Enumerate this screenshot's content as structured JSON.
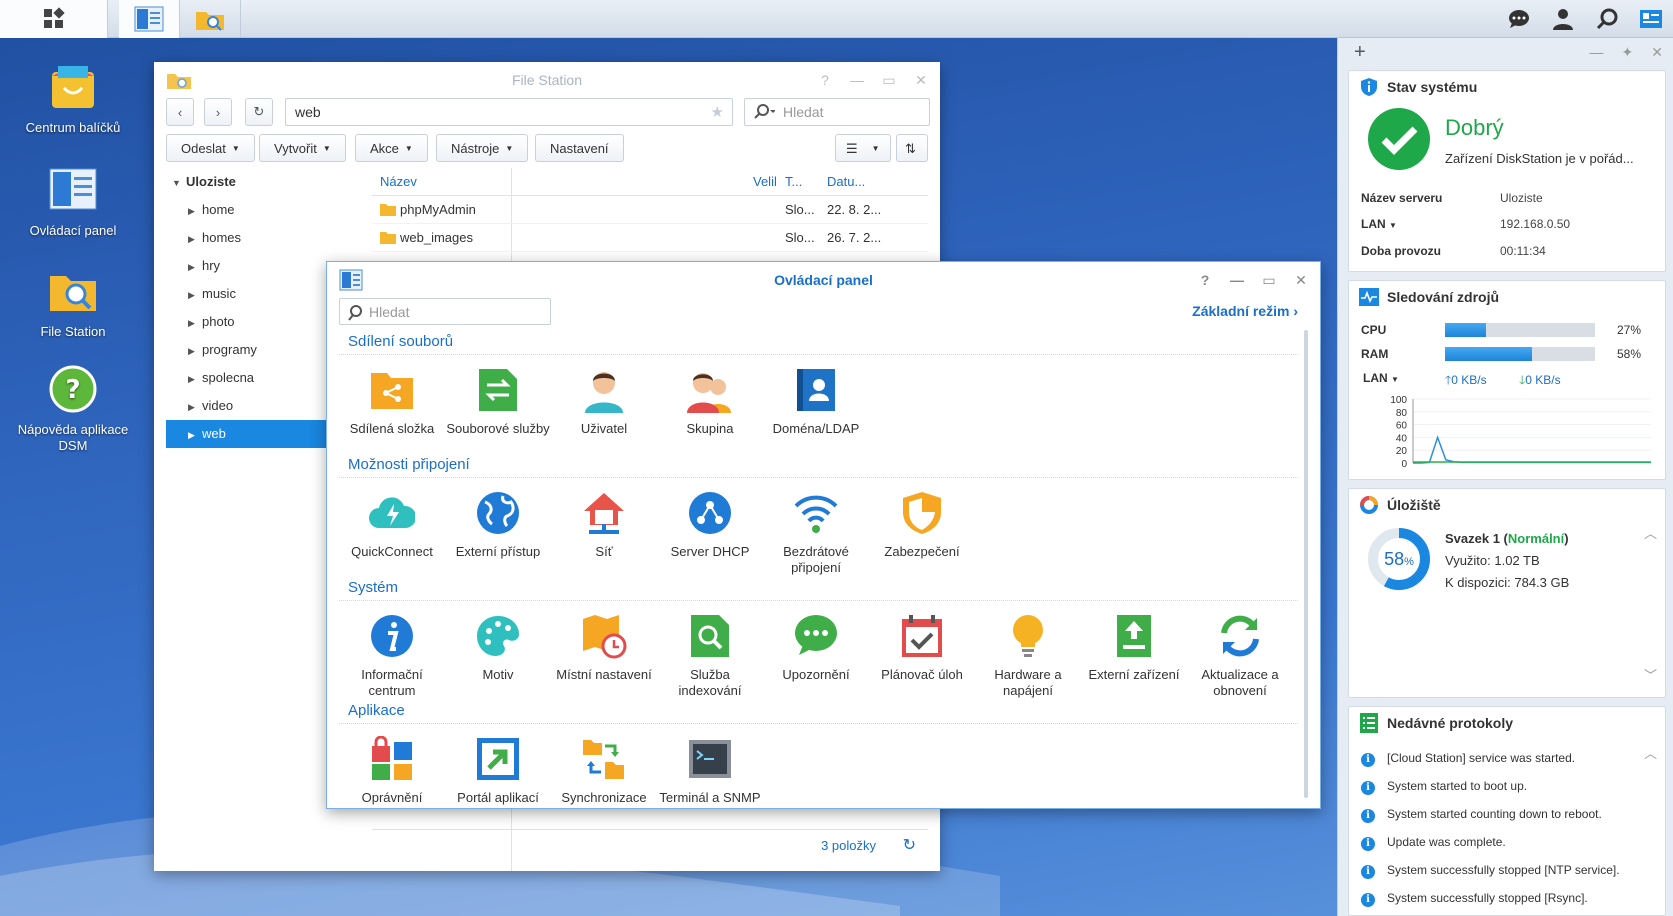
{
  "taskbar": {
    "buttons": [
      "main-menu",
      "control-panel",
      "file-station"
    ]
  },
  "desktop": {
    "icons": [
      {
        "label": "Centrum balíčků"
      },
      {
        "label": "Ovládací panel"
      },
      {
        "label": "File Station"
      },
      {
        "label": "Nápověda aplikace DSM"
      }
    ]
  },
  "file_station": {
    "title": "File Station",
    "path": "web",
    "search_placeholder": "Hledat",
    "toolbar": [
      "Odeslat",
      "Vytvořit",
      "Akce",
      "Nástroje",
      "Nastavení"
    ],
    "tree_root": "Uloziste",
    "tree": [
      "home",
      "homes",
      "hry",
      "music",
      "photo",
      "programy",
      "spolecna",
      "video",
      "web"
    ],
    "selected": "web",
    "columns": [
      "Název",
      "Velil",
      "T...",
      "Datu..."
    ],
    "rows": [
      {
        "name": "phpMyAdmin",
        "type": "Slo...",
        "date": "22. 8. 2..."
      },
      {
        "name": "web_images",
        "type": "Slo...",
        "date": "26. 7. 2..."
      }
    ],
    "status": "3 položky"
  },
  "control_panel": {
    "title": "Ovládací panel",
    "search_placeholder": "Hledat",
    "mode_link": "Základní režim",
    "sections": [
      {
        "title": "Sdílení souborů",
        "items": [
          "Sdílená složka",
          "Souborové služby",
          "Uživatel",
          "Skupina",
          "Doména/LDAP"
        ]
      },
      {
        "title": "Možnosti připojení",
        "items": [
          "QuickConnect",
          "Externí přístup",
          "Síť",
          "Server DHCP",
          "Bezdrátové připojení",
          "Zabezpečení"
        ]
      },
      {
        "title": "Systém",
        "items": [
          "Informační centrum",
          "Motiv",
          "Místní nastavení",
          "Služba indexování",
          "Upozornění",
          "Plánovač úloh",
          "Hardware a napájení",
          "Externí zařízení",
          "Aktualizace a obnovení"
        ]
      },
      {
        "title": "Aplikace",
        "items": [
          "Oprávnění",
          "Portál aplikací",
          "Synchronizace sdílených",
          "Terminál a SNMP"
        ]
      }
    ]
  },
  "widgets": {
    "system_status": {
      "title": "Stav systému",
      "status": "Dobrý",
      "message": "Zařízení DiskStation je v pořád...",
      "server_name_label": "Název serveru",
      "server_name": "Uloziste",
      "lan_label": "LAN",
      "lan_ip": "192.168.0.50",
      "uptime_label": "Doba provozu",
      "uptime": "00:11:34"
    },
    "resource_monitor": {
      "title": "Sledování zdrojů",
      "cpu_label": "CPU",
      "cpu_percent": 27,
      "cpu_text": "27%",
      "ram_label": "RAM",
      "ram_percent": 58,
      "ram_text": "58%",
      "lan_label": "LAN",
      "upload": "0 KB/s",
      "download": "0 KB/s"
    },
    "storage": {
      "title": "Úložiště",
      "percent": "58",
      "percent_unit": "%",
      "volume": "Svazek 1",
      "volume_status": "Normální",
      "used": "Využito: 1.02 TB",
      "free": "K dispozici: 784.3 GB"
    },
    "logs": {
      "title": "Nedávné protokoly",
      "entries": [
        "[Cloud Station] service was started.",
        "System started to boot up.",
        "System started counting down to reboot.",
        "Update was complete.",
        "System successfully stopped [NTP service].",
        "System successfully stopped [Rsync]."
      ]
    }
  },
  "chart_data": {
    "type": "line",
    "title": "",
    "ylim": [
      0,
      100
    ],
    "y_ticks": [
      "100",
      "80",
      "60",
      "40",
      "20",
      "0"
    ],
    "series": [
      {
        "values": [
          0,
          0,
          1,
          40,
          5,
          2,
          1,
          1,
          1,
          1,
          1,
          1,
          1,
          1,
          1,
          1,
          1,
          1,
          1,
          1,
          1,
          1,
          1,
          1,
          1,
          1,
          1,
          1,
          1,
          1
        ]
      }
    ],
    "colors": [
      "#2d8fe3",
      "#2fb344"
    ]
  }
}
